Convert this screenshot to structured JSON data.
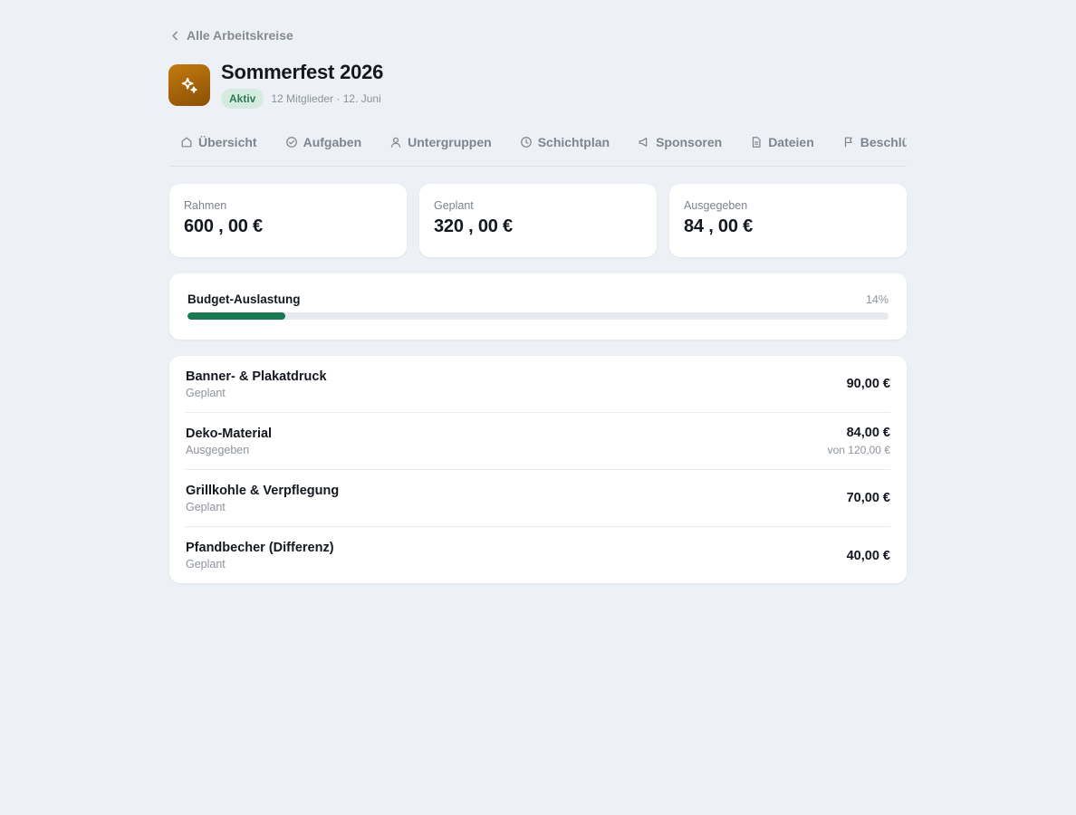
{
  "nav": {
    "back_label": "Alle Arbeitskreise"
  },
  "header": {
    "title": "Sommerfest 2026",
    "status": "Aktiv",
    "meta": "12 Mitglieder · 12. Juni",
    "icon": "sparkles-icon",
    "accent": "#b06c0a"
  },
  "tabs": [
    {
      "label": "Übersicht",
      "icon": "home-icon"
    },
    {
      "label": "Aufgaben",
      "icon": "check-circle-icon"
    },
    {
      "label": "Untergruppen",
      "icon": "user-icon"
    },
    {
      "label": "Schichtplan",
      "icon": "clock-icon"
    },
    {
      "label": "Sponsoren",
      "icon": "megaphone-icon"
    },
    {
      "label": "Dateien",
      "icon": "file-icon"
    },
    {
      "label": "Beschlüsse",
      "icon": "flag-icon"
    }
  ],
  "stats": [
    {
      "label": "Rahmen",
      "value": "600 , 00 €"
    },
    {
      "label": "Geplant",
      "value": "320 , 00 €"
    },
    {
      "label": "Ausgegeben",
      "value": "84 , 00 €"
    }
  ],
  "budget": {
    "label": "Budget-Auslastung",
    "percent_text": "14%",
    "fill_fraction": 0.14,
    "bar_color": "#187a52"
  },
  "items": [
    {
      "name": "Banner- & Plakatdruck",
      "status": "Geplant",
      "amount": "90,00 €",
      "sub": ""
    },
    {
      "name": "Deko-Material",
      "status": "Ausgegeben",
      "amount": "84,00 €",
      "sub": "von 120,00 €"
    },
    {
      "name": "Grillkohle & Verpflegung",
      "status": "Geplant",
      "amount": "70,00 €",
      "sub": ""
    },
    {
      "name": "Pfandbecher (Differenz)",
      "status": "Geplant",
      "amount": "40,00 €",
      "sub": ""
    }
  ]
}
